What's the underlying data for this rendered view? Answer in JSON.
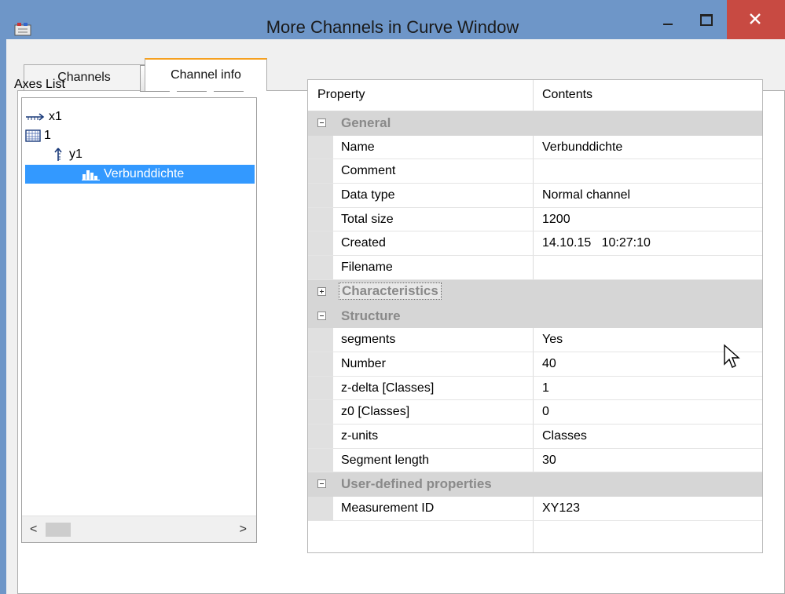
{
  "window": {
    "title": "More Channels in Curve Window",
    "icons": {
      "app": "app-window-icon",
      "minimize": "minimize-icon",
      "maximize": "maximize-icon",
      "close": "close-icon"
    }
  },
  "tabs": [
    {
      "label": "Channels",
      "active": false
    },
    {
      "label": "Channel info",
      "active": true
    }
  ],
  "axes_list": {
    "label": "Axes List",
    "toolbar": [
      {
        "icon": "add-axis-icon"
      },
      {
        "icon": "add-grid-icon"
      },
      {
        "icon": "trash-icon"
      }
    ],
    "tree": {
      "x_axis": "x1",
      "group": "1",
      "y_axis": "y1",
      "channel": "Verbunddichte"
    },
    "scroll": {
      "left": "<",
      "right": ">"
    }
  },
  "property_grid": {
    "header": {
      "property": "Property",
      "contents": "Contents"
    },
    "general": {
      "label": "General",
      "name": {
        "k": "Name",
        "v": "Verbunddichte"
      },
      "comment": {
        "k": "Comment",
        "v": ""
      },
      "data_type": {
        "k": "Data type",
        "v": "Normal channel"
      },
      "total_size": {
        "k": "Total size",
        "v": "1200"
      },
      "created": {
        "k": "Created",
        "v": "14.10.15   10:27:10"
      },
      "filename": {
        "k": "Filename",
        "v": ""
      }
    },
    "characteristics": {
      "label": "Characteristics"
    },
    "structure": {
      "label": "Structure",
      "segments": {
        "k": "segments",
        "v": "Yes"
      },
      "number": {
        "k": "Number",
        "v": "40"
      },
      "z_delta": {
        "k": "z-delta [Classes]",
        "v": "1"
      },
      "z0": {
        "k": "z0 [Classes]",
        "v": "0"
      },
      "z_units": {
        "k": "z-units",
        "v": "Classes"
      },
      "segment_length": {
        "k": "Segment length",
        "v": "30"
      }
    },
    "user_defined": {
      "label": "User-defined properties",
      "measurement_id": {
        "k": "Measurement ID",
        "v": "XY123"
      }
    }
  },
  "colors": {
    "titlebar": "#6e96c8",
    "close": "#c84a42",
    "selection": "#3399ff",
    "tab_accent": "#f5a020"
  }
}
